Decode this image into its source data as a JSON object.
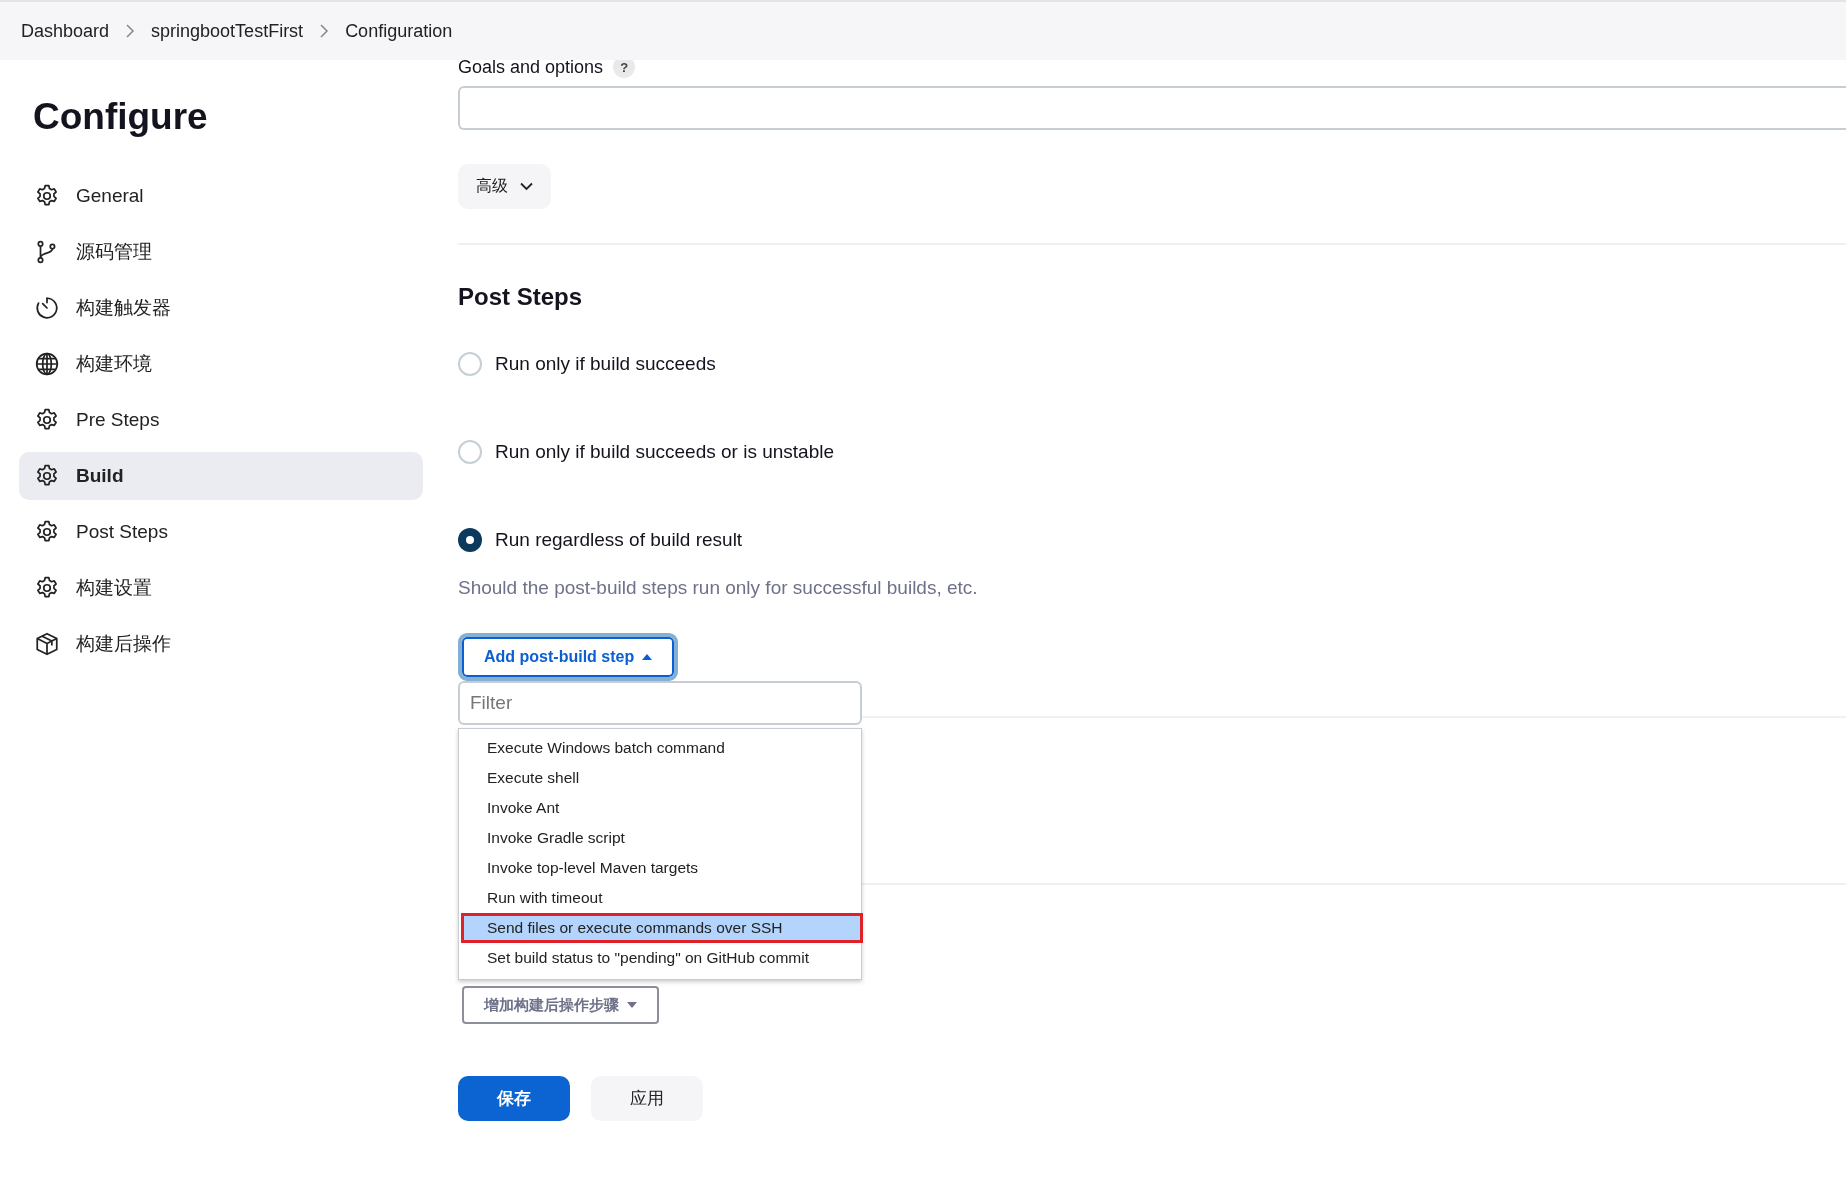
{
  "breadcrumbs": [
    "Dashboard",
    "springbootTestFirst",
    "Configuration"
  ],
  "sidebar": {
    "title": "Configure",
    "items": [
      {
        "label": "General",
        "selected": false
      },
      {
        "label": "源码管理",
        "selected": false
      },
      {
        "label": "构建触发器",
        "selected": false
      },
      {
        "label": "构建环境",
        "selected": false
      },
      {
        "label": "Pre Steps",
        "selected": false
      },
      {
        "label": "Build",
        "selected": true
      },
      {
        "label": "Post Steps",
        "selected": false
      },
      {
        "label": "构建设置",
        "selected": false
      },
      {
        "label": "构建后操作",
        "selected": false
      }
    ]
  },
  "goals": {
    "label": "Goals and options",
    "help": "?"
  },
  "advanced_button": "高级",
  "post_steps": {
    "title": "Post Steps",
    "options": [
      {
        "label": "Run only if build succeeds",
        "selected": false
      },
      {
        "label": "Run only if build succeeds or is unstable",
        "selected": false
      },
      {
        "label": "Run regardless of build result",
        "selected": true
      }
    ],
    "description": "Should the post-build steps run only for successful builds, etc."
  },
  "add_step": {
    "label": "Add post-build step",
    "expanded": true,
    "filter_placeholder": "Filter",
    "items": [
      {
        "label": "Execute Windows batch command",
        "selected": false
      },
      {
        "label": "Execute shell",
        "selected": false
      },
      {
        "label": "Invoke Ant",
        "selected": false
      },
      {
        "label": "Invoke Gradle script",
        "selected": false
      },
      {
        "label": "Invoke top-level Maven targets",
        "selected": false
      },
      {
        "label": "Run with timeout",
        "selected": false
      },
      {
        "label": "Send files or execute commands over SSH",
        "selected": true
      },
      {
        "label": "Set build status to \"pending\" on GitHub commit",
        "selected": false
      }
    ]
  },
  "post_build_button": "增加构建后操作步骤",
  "save_button": "保存",
  "apply_button": "应用"
}
